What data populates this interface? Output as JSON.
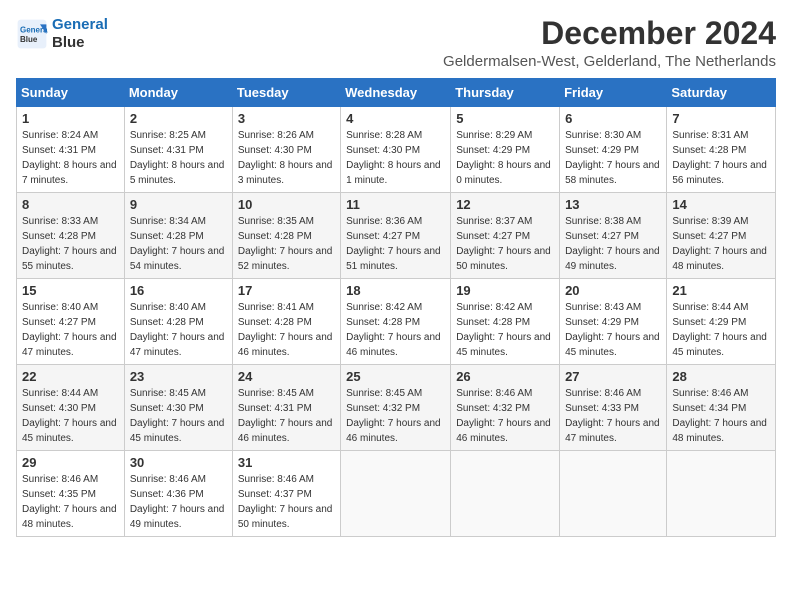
{
  "header": {
    "logo_line1": "General",
    "logo_line2": "Blue",
    "month_year": "December 2024",
    "location": "Geldermalsen-West, Gelderland, The Netherlands"
  },
  "weekdays": [
    "Sunday",
    "Monday",
    "Tuesday",
    "Wednesday",
    "Thursday",
    "Friday",
    "Saturday"
  ],
  "weeks": [
    [
      {
        "day": "1",
        "sunrise": "8:24 AM",
        "sunset": "4:31 PM",
        "daylight": "8 hours and 7 minutes."
      },
      {
        "day": "2",
        "sunrise": "8:25 AM",
        "sunset": "4:31 PM",
        "daylight": "8 hours and 5 minutes."
      },
      {
        "day": "3",
        "sunrise": "8:26 AM",
        "sunset": "4:30 PM",
        "daylight": "8 hours and 3 minutes."
      },
      {
        "day": "4",
        "sunrise": "8:28 AM",
        "sunset": "4:30 PM",
        "daylight": "8 hours and 1 minute."
      },
      {
        "day": "5",
        "sunrise": "8:29 AM",
        "sunset": "4:29 PM",
        "daylight": "8 hours and 0 minutes."
      },
      {
        "day": "6",
        "sunrise": "8:30 AM",
        "sunset": "4:29 PM",
        "daylight": "7 hours and 58 minutes."
      },
      {
        "day": "7",
        "sunrise": "8:31 AM",
        "sunset": "4:28 PM",
        "daylight": "7 hours and 56 minutes."
      }
    ],
    [
      {
        "day": "8",
        "sunrise": "8:33 AM",
        "sunset": "4:28 PM",
        "daylight": "7 hours and 55 minutes."
      },
      {
        "day": "9",
        "sunrise": "8:34 AM",
        "sunset": "4:28 PM",
        "daylight": "7 hours and 54 minutes."
      },
      {
        "day": "10",
        "sunrise": "8:35 AM",
        "sunset": "4:28 PM",
        "daylight": "7 hours and 52 minutes."
      },
      {
        "day": "11",
        "sunrise": "8:36 AM",
        "sunset": "4:27 PM",
        "daylight": "7 hours and 51 minutes."
      },
      {
        "day": "12",
        "sunrise": "8:37 AM",
        "sunset": "4:27 PM",
        "daylight": "7 hours and 50 minutes."
      },
      {
        "day": "13",
        "sunrise": "8:38 AM",
        "sunset": "4:27 PM",
        "daylight": "7 hours and 49 minutes."
      },
      {
        "day": "14",
        "sunrise": "8:39 AM",
        "sunset": "4:27 PM",
        "daylight": "7 hours and 48 minutes."
      }
    ],
    [
      {
        "day": "15",
        "sunrise": "8:40 AM",
        "sunset": "4:27 PM",
        "daylight": "7 hours and 47 minutes."
      },
      {
        "day": "16",
        "sunrise": "8:40 AM",
        "sunset": "4:28 PM",
        "daylight": "7 hours and 47 minutes."
      },
      {
        "day": "17",
        "sunrise": "8:41 AM",
        "sunset": "4:28 PM",
        "daylight": "7 hours and 46 minutes."
      },
      {
        "day": "18",
        "sunrise": "8:42 AM",
        "sunset": "4:28 PM",
        "daylight": "7 hours and 46 minutes."
      },
      {
        "day": "19",
        "sunrise": "8:42 AM",
        "sunset": "4:28 PM",
        "daylight": "7 hours and 45 minutes."
      },
      {
        "day": "20",
        "sunrise": "8:43 AM",
        "sunset": "4:29 PM",
        "daylight": "7 hours and 45 minutes."
      },
      {
        "day": "21",
        "sunrise": "8:44 AM",
        "sunset": "4:29 PM",
        "daylight": "7 hours and 45 minutes."
      }
    ],
    [
      {
        "day": "22",
        "sunrise": "8:44 AM",
        "sunset": "4:30 PM",
        "daylight": "7 hours and 45 minutes."
      },
      {
        "day": "23",
        "sunrise": "8:45 AM",
        "sunset": "4:30 PM",
        "daylight": "7 hours and 45 minutes."
      },
      {
        "day": "24",
        "sunrise": "8:45 AM",
        "sunset": "4:31 PM",
        "daylight": "7 hours and 46 minutes."
      },
      {
        "day": "25",
        "sunrise": "8:45 AM",
        "sunset": "4:32 PM",
        "daylight": "7 hours and 46 minutes."
      },
      {
        "day": "26",
        "sunrise": "8:46 AM",
        "sunset": "4:32 PM",
        "daylight": "7 hours and 46 minutes."
      },
      {
        "day": "27",
        "sunrise": "8:46 AM",
        "sunset": "4:33 PM",
        "daylight": "7 hours and 47 minutes."
      },
      {
        "day": "28",
        "sunrise": "8:46 AM",
        "sunset": "4:34 PM",
        "daylight": "7 hours and 48 minutes."
      }
    ],
    [
      {
        "day": "29",
        "sunrise": "8:46 AM",
        "sunset": "4:35 PM",
        "daylight": "7 hours and 48 minutes."
      },
      {
        "day": "30",
        "sunrise": "8:46 AM",
        "sunset": "4:36 PM",
        "daylight": "7 hours and 49 minutes."
      },
      {
        "day": "31",
        "sunrise": "8:46 AM",
        "sunset": "4:37 PM",
        "daylight": "7 hours and 50 minutes."
      },
      null,
      null,
      null,
      null
    ]
  ]
}
